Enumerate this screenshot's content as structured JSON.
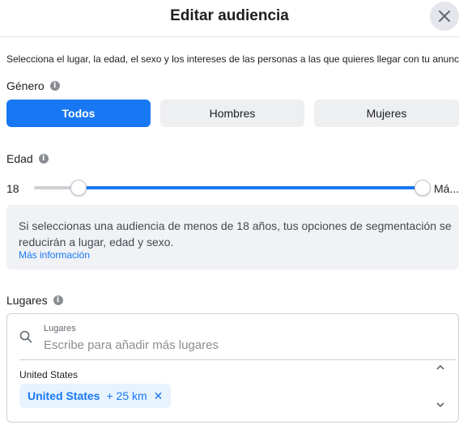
{
  "header": {
    "title": "Editar audiencia",
    "close_icon": "close-icon"
  },
  "intro": "Selecciona el lugar, la edad, el sexo y los intereses de las personas a las que quieres llegar con tu anuncio.",
  "gender": {
    "label": "Género",
    "options": [
      "Todos",
      "Hombres",
      "Mujeres"
    ],
    "selected": "Todos"
  },
  "age": {
    "label": "Edad",
    "min_label": "18",
    "max_label": "Má...",
    "min_value": 18,
    "max_value": "Máximo"
  },
  "notice": {
    "text": "Si seleccionas una audiencia de menos de 18 años, tus opciones de segmentación se reducirán a lugar, edad y sexo.",
    "link": "Más información"
  },
  "locations": {
    "label": "Lugares",
    "search_label": "Lugares",
    "search_placeholder": "Escribe para añadir más lugares",
    "country": "United States",
    "chip_name": "United States",
    "chip_radius": "+ 25 km",
    "chip_remove": "✕"
  },
  "colors": {
    "accent": "#1877f2",
    "chip_bg": "#e7f3ff",
    "notice_bg": "#f0f2f5"
  }
}
